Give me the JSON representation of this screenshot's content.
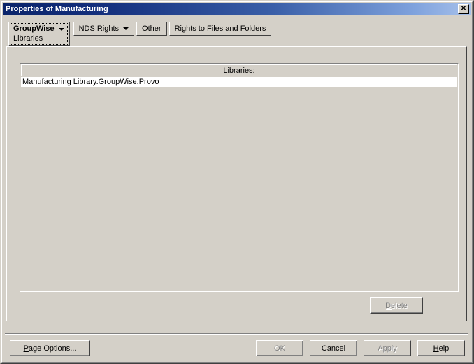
{
  "window": {
    "title": "Properties of Manufacturing",
    "close_icon": "close-icon",
    "close_glyph": "✕"
  },
  "tabs": [
    {
      "label": "GroupWise",
      "sub_label": "Libraries",
      "has_dropdown": true,
      "selected": true
    },
    {
      "label": "NDS Rights",
      "has_dropdown": true,
      "selected": false
    },
    {
      "label": "Other",
      "has_dropdown": false,
      "selected": false
    },
    {
      "label": "Rights to Files and Folders",
      "has_dropdown": false,
      "selected": false
    }
  ],
  "list": {
    "header": "Libraries:",
    "rows": [
      "Manufacturing Library.GroupWise.Provo"
    ]
  },
  "buttons": {
    "delete": {
      "label": "Delete",
      "accel": "D",
      "enabled": false
    },
    "page_options": {
      "label": "Page Options...",
      "accel": "P",
      "enabled": true
    },
    "ok": {
      "label": "OK",
      "enabled": false
    },
    "cancel": {
      "label": "Cancel",
      "enabled": true
    },
    "apply": {
      "label": "Apply",
      "enabled": false
    },
    "help": {
      "label": "Help",
      "accel": "H",
      "enabled": true
    }
  },
  "colors": {
    "face": "#d4d0c8",
    "title_start": "#0a246a",
    "title_end": "#a6c0ea",
    "list_row_bg": "#ffffff",
    "disabled_text": "#808080"
  }
}
